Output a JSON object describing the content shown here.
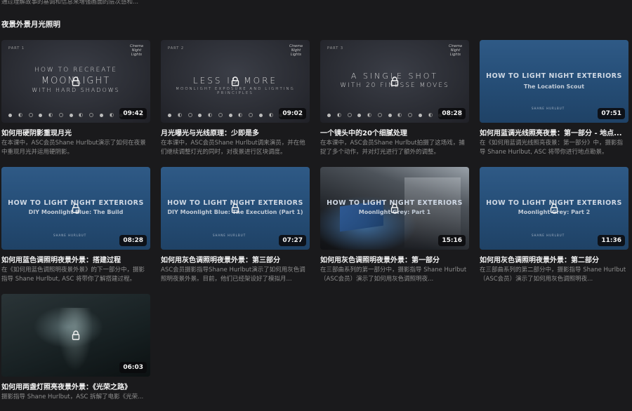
{
  "page": {
    "top_description": "通过理解故事的基调和信息来增强画面的层次感和...",
    "section_title": "夜景外景月光照明"
  },
  "videos": [
    {
      "thumb_main": "HOW TO RECREATE",
      "thumb_big": "MOONLIGHT",
      "thumb_sub": "WITH HARD SHADOWS",
      "thumb_part": "PART 1",
      "duration": "09:42",
      "title": "如何用硬阴影重现月光",
      "desc": "在本课中，ASC会员Shane Hurlbut演示了如何在夜景中重现月光并运用硬阴影。"
    },
    {
      "thumb_big": "LESS IS MORE",
      "thumb_sub": "MOONLIGHT EXPOSURE AND LIGHTING PRINCIPLES",
      "thumb_part": "PART 2",
      "duration": "09:02",
      "title": "月光曝光与光线原理：少即是多",
      "desc": "在本课中，ASC会员Shane Hurlbut调来演员，并在他们继续调整灯光的同时，对夜景进行区块调度。"
    },
    {
      "thumb_main": "A SINGLE SHOT",
      "thumb_sub": "WITH 20 FINESSE MOVES",
      "thumb_part": "PART 3",
      "duration": "08:28",
      "title": "一个镜头中的20个细腻处理",
      "desc": "在本课中，ASC会员Shane Hurlbut拍摄了这场戏，捕捉了多个动作，并对灯光进行了额外的调整。"
    },
    {
      "thumb_main": "HOW TO LIGHT NIGHT EXTERIORS",
      "thumb_sub": "The Location Scout",
      "duration": "07:51",
      "title": "如何用蓝调光线照亮夜景：第一部分 - 地点...",
      "desc": "在《如何用蓝调光线照亮夜景：第一部分》中，摄影指导 Shane Hurlbut, ASC 将带你进行地点勘景。"
    },
    {
      "thumb_main": "HOW TO LIGHT NIGHT EXTERIORS",
      "thumb_sub": "DIY Moonlight Blue: The Build",
      "duration": "08:28",
      "title": "如何用蓝色调照明夜景外景：搭建过程",
      "desc": "在《如何用蓝色调照明夜景外景》的下一部分中，摄影指导 Shane Hurlbut, ASC 将带你了解搭建过程。"
    },
    {
      "thumb_main": "HOW TO LIGHT NIGHT EXTERIORS",
      "thumb_sub": "DIY Moonlight Blue: The Execution (Part 1)",
      "duration": "07:27",
      "title": "如何用灰色调照明夜景外景：第三部分",
      "desc": "ASC会员摄影指导Shane Hurlbut演示了如何用灰色调照明夜景外景。目前，他们已经架设好了模拟月..."
    },
    {
      "thumb_main": "HOW TO LIGHT NIGHT EXTERIORS",
      "thumb_sub": "Moonlight Grey: Part 1",
      "duration": "15:16",
      "title": "如何用灰色调照明夜景外景：第一部分",
      "desc": "在三部曲系列的第一部分中，摄影指导 Shane Hurlbut（ASC会员）演示了如何用灰色调照明夜..."
    },
    {
      "thumb_main": "HOW TO LIGHT NIGHT EXTERIORS",
      "thumb_sub": "Moonlight Grey: Part 2",
      "duration": "11:36",
      "title": "如何用灰色调照明夜景外景：第二部分",
      "desc": "在三部曲系列的第二部分中，摄影指导 Shane Hurlbut（ASC会员）演示了如何用灰色调照明夜..."
    },
    {
      "duration": "06:03",
      "title": "如何用两盏灯照亮夜景外景：《光荣之路》",
      "desc": "摄影指导 Shane Hurlbut，ASC 拆解了电影《光荣..."
    }
  ],
  "icons": {
    "lock": "lock-icon"
  },
  "colors": {
    "background": "#1a1a1c",
    "card_title": "#f2f2f2",
    "card_desc": "#8e8e8e",
    "duration_bg": "#0a0a0c"
  }
}
